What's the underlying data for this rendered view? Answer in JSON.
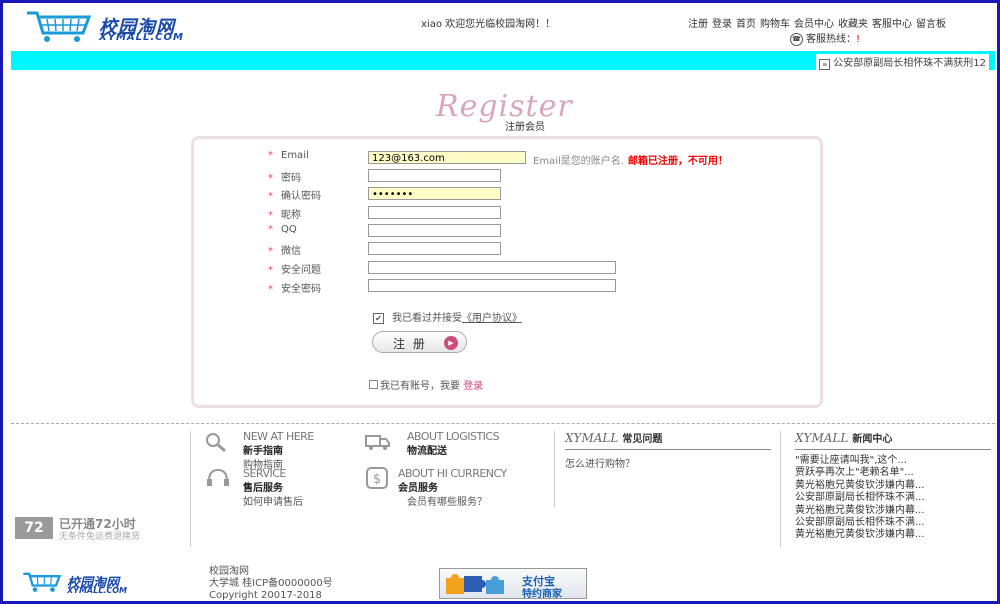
{
  "header": {
    "logo_cn": "校园淘网",
    "logo_en": "XYMALL.COM",
    "welcome": "xiao 欢迎您光临校园淘网！！",
    "nav": [
      "注册",
      "登录",
      "首页",
      "购物车",
      "会员中心",
      "收藏夹",
      "客服中心",
      "留言板"
    ],
    "hotline_label": "客服热线：",
    "hotline_value": "!"
  },
  "ticker": {
    "text": "公安部原副局长相怀珠不满获刑12"
  },
  "register": {
    "title_en": "Register",
    "title_cn": "注册会员",
    "fields": {
      "email": {
        "label": "Email",
        "value": "123@163.com"
      },
      "password": {
        "label": "密码",
        "value": ""
      },
      "confirm": {
        "label": "确认密码",
        "value": "•••••••"
      },
      "nickname": {
        "label": "昵称",
        "value": ""
      },
      "qq": {
        "label": "QQ",
        "value": ""
      },
      "wechat": {
        "label": "微信",
        "value": ""
      },
      "question": {
        "label": "安全问题",
        "value": ""
      },
      "answer": {
        "label": "安全密码",
        "value": ""
      }
    },
    "email_hint": "Email是您的账户名.",
    "email_error": "邮箱已注册，不可用！",
    "agree_text": "我已看过并接受",
    "agree_link": "《用户协议》",
    "agree_checked": true,
    "submit_label": "注 册",
    "have_account": "我已有账号，我要",
    "login_link": "登录"
  },
  "services": [
    {
      "en": "NEW AT HERE",
      "cn": "新手指南",
      "link": "购物指南"
    },
    {
      "en": "ABOUT LOGISTICS",
      "cn": "物流配送",
      "link": ""
    },
    {
      "en": "SERVICE",
      "cn": "售后服务",
      "link": "如何申请售后"
    },
    {
      "en": "ABOUT HI CURRENCY",
      "cn": "会员服务",
      "link": "会员有哪些服务？"
    }
  ],
  "faq": {
    "brand": "XYMALL",
    "title": "常见问题",
    "items": [
      "怎么进行购物？"
    ]
  },
  "news": {
    "brand": "XYMALL",
    "title": "新闻中心",
    "items": [
      "\"需要让座请叫我\",这个...",
      "贾跃亭再次上\"老赖名单\"...",
      "黄光裕胞兄黄俊钦涉嫌内幕...",
      "公安部原副局长相怀珠不满...",
      "黄光裕胞兄黄俊钦涉嫌内幕...",
      "公安部原副局长相怀珠不满...",
      "黄光裕胞兄黄俊钦涉嫌内幕..."
    ]
  },
  "badge": {
    "number": "72",
    "title": "已开通72小时",
    "subtitle": "无条件免运费退换货"
  },
  "footer": {
    "logo_cn": "校园淘网",
    "logo_en": "XYMALL.COM",
    "lines": [
      "校园淘网",
      "大学城 桂ICP备0000000号",
      "Copyright 20017-2018"
    ],
    "alipay_line1": "支付宝",
    "alipay_line2": "特约商家"
  },
  "colors": {
    "accent_pink": "#d2477a",
    "cyan_bar": "#00f5ff",
    "brand_blue": "#1a49a8",
    "error_red": "#ee0000"
  }
}
